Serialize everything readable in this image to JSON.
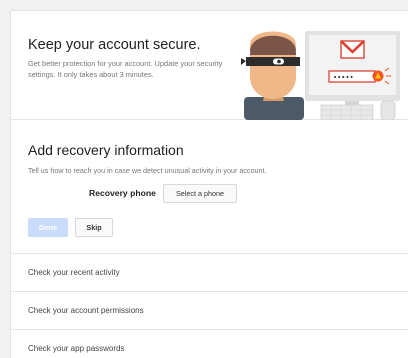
{
  "hero": {
    "title": "Keep your account secure.",
    "description": "Get better protection for your account. Update your security settings. It only takes about 3 minutes.",
    "password_mask": "•••••"
  },
  "recovery": {
    "title": "Add recovery information",
    "description": "Tell us how to reach you in case we detect unusual activity in your account.",
    "phone_label": "Recovery phone",
    "select_phone_label": "Select a phone",
    "done_label": "Done",
    "skip_label": "Skip"
  },
  "sections": [
    {
      "label": "Check your recent activity"
    },
    {
      "label": "Check your account permissions"
    },
    {
      "label": "Check your app passwords"
    }
  ],
  "colors": {
    "accent": "#4285f4",
    "done_disabled": "#c9dcfb",
    "gmail_red": "#db4437",
    "warning": "#f4511e"
  },
  "icons": [
    "thief-illustration",
    "gmail-icon",
    "warning-icon",
    "keyboard-icon",
    "monitor-icon"
  ]
}
